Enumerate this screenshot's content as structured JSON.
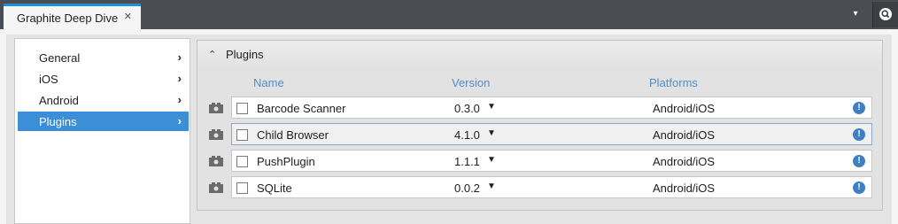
{
  "tab": {
    "title": "Graphite Deep Dive",
    "close": "✕"
  },
  "toolbar": {
    "overflow": "▾"
  },
  "sidebar": {
    "items": [
      {
        "label": "General"
      },
      {
        "label": "iOS"
      },
      {
        "label": "Android"
      },
      {
        "label": "Plugins",
        "active": true
      }
    ]
  },
  "plugins": {
    "title": "Plugins",
    "columns": {
      "name": "Name",
      "version": "Version",
      "platforms": "Platforms"
    },
    "rows": [
      {
        "name": "Barcode Scanner",
        "version": "0.3.0",
        "platforms": "Android/iOS",
        "checked": false
      },
      {
        "name": "Child Browser",
        "version": "4.1.0",
        "platforms": "Android/iOS",
        "checked": false,
        "selected": true
      },
      {
        "name": "PushPlugin",
        "version": "1.1.1",
        "platforms": "Android/iOS",
        "checked": false
      },
      {
        "name": "SQLite",
        "version": "0.0.2",
        "platforms": "Android/iOS",
        "checked": false
      }
    ]
  },
  "colors": {
    "accent": "#1d8fd6",
    "active_item": "#3c8fd6",
    "column_header": "#4f8fcf",
    "info": "#3f7fc3"
  }
}
